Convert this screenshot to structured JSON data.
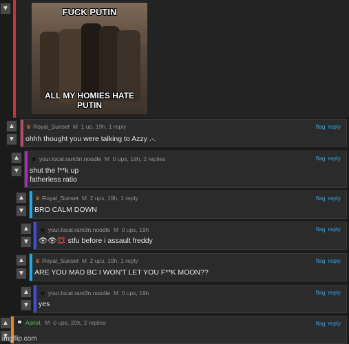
{
  "meme": {
    "caption_top": "FUCK PUTIN",
    "caption_bottom": "ALL MY HOMIES HATE PUTIN"
  },
  "vote": {
    "up_glyph": "▲",
    "down_glyph": "▼"
  },
  "comments": [
    {
      "user": "Royal_Sunset",
      "badge": "M",
      "meta": "1 up, 19h, 1 reply",
      "body": "ohhh thought you were talking to Azzy .-.",
      "flag": "flag",
      "reply": "reply",
      "bar_color": "#b94a6a"
    },
    {
      "user": "your.local.ram3n.noodle",
      "badge": "M",
      "meta": "0 ups, 19h, 2 replies",
      "body": "shut the f**k up\nfatherless ratio",
      "flag": "flag",
      "reply": "reply",
      "bar_color": "#a22cc4"
    },
    {
      "user": "Royal_Sunset",
      "badge": "M",
      "meta": "2 ups, 19h, 1 reply",
      "body": "BRO CALM DOWN",
      "flag": "flag",
      "reply": "reply",
      "bar_color": "#1ea8e6"
    },
    {
      "user": "your.local.ram3n.noodle",
      "badge": "M",
      "meta": "0 ups, 19h",
      "body": "👁👁💢 stfu before i assault freddy",
      "flag": "flag",
      "reply": "reply",
      "bar_color": "#3b4fd0"
    },
    {
      "user": "Royal_Sunset",
      "badge": "M",
      "meta": "2 ups, 19h, 1 reply",
      "body": "ARE YOU MAD BC I WON'T LET YOU F**K MOON??",
      "flag": "flag",
      "reply": "reply",
      "bar_color": "#1ea8e6"
    },
    {
      "user": "your.local.ram3n.noodle",
      "badge": "M",
      "meta": "0 ups, 19h",
      "body": "yes",
      "flag": "flag",
      "reply": "reply",
      "bar_color": "#3b4fd0"
    },
    {
      "user": "Asriel.",
      "badge": "M",
      "meta": "0 ups, 20h, 2 replies",
      "body": "",
      "flag": "flag",
      "reply": "reply",
      "bar_color": "#e6891e"
    }
  ],
  "watermark": "imgflip.com",
  "colors": {
    "accent_link": "#38a6e0",
    "top_bar": "#c8333a"
  }
}
